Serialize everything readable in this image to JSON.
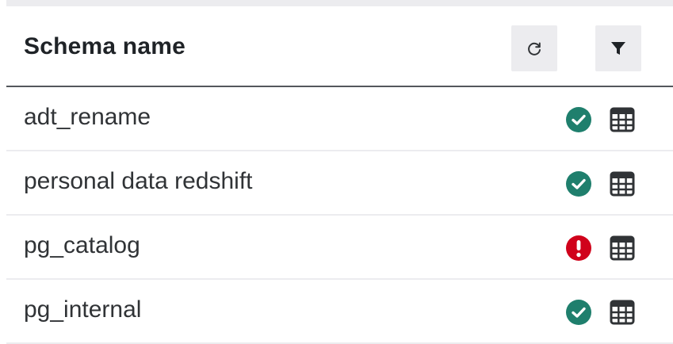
{
  "header": {
    "title": "Schema name",
    "actions": [
      {
        "name": "refresh",
        "icon": "refresh-icon"
      },
      {
        "name": "filter",
        "icon": "filter-icon"
      }
    ]
  },
  "schemas": [
    {
      "name": "adt_rename",
      "status": "success",
      "status_icon": "check-circle-icon",
      "action_icon": "table-icon"
    },
    {
      "name": "personal data redshift",
      "status": "success",
      "status_icon": "check-circle-icon",
      "action_icon": "table-icon"
    },
    {
      "name": "pg_catalog",
      "status": "error",
      "status_icon": "exclamation-circle-icon",
      "action_icon": "table-icon"
    },
    {
      "name": "pg_internal",
      "status": "success",
      "status_icon": "check-circle-icon",
      "action_icon": "table-icon"
    }
  ],
  "colors": {
    "success": "#1f7f6d",
    "error": "#d0021b",
    "header_rule": "#54575c",
    "button_bg": "#ececef",
    "text": "#303336"
  }
}
